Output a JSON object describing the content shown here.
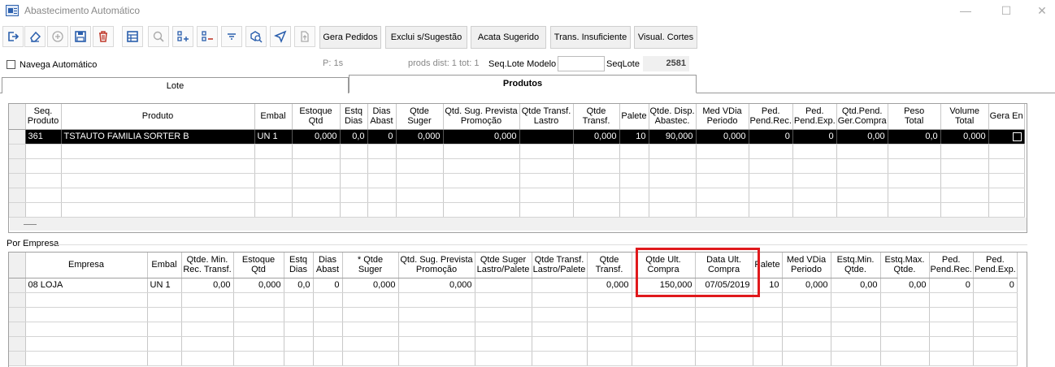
{
  "window": {
    "title": "Abastecimento Automático",
    "minimize": "—",
    "maximize": "☐",
    "close": "✕"
  },
  "toolbar": {
    "icons": [
      "exit-icon",
      "eraser-icon",
      "add-icon",
      "save-icon",
      "delete-icon",
      "table-icon",
      "search-icon",
      "add-row-icon",
      "remove-row-icon",
      "filter-icon",
      "inspect-icon",
      "send-icon",
      "export-icon"
    ],
    "buttons": [
      "Gera Pedidos",
      "Exclui s/Sugestão",
      "Acata Sugerido",
      "Trans. Insuficiente",
      "Visual. Cortes"
    ]
  },
  "info": {
    "navega_label": "Navega Automático",
    "p_label": "P: 1s",
    "prods_label": "prods dist: 1  tot: 1",
    "seq_lote_modelo_label": "Seq.Lote Modelo",
    "seq_lote_modelo_value": "",
    "seqlote_label": "SeqLote",
    "seqlote_value": "2581"
  },
  "tabs": [
    "Lote",
    "Produtos"
  ],
  "products_grid": {
    "headers": [
      [
        "Seq.",
        "Produto"
      ],
      [
        "Produto",
        ""
      ],
      [
        "Embal",
        ""
      ],
      [
        "Estoque",
        "Qtd"
      ],
      [
        "Estq",
        "Dias"
      ],
      [
        "Dias",
        "Abast"
      ],
      [
        "Qtde",
        "Suger"
      ],
      [
        "Qtd. Sug. Prevista",
        "Promoção"
      ],
      [
        "Qtde Transf.",
        "Lastro"
      ],
      [
        "Qtde",
        "Transf."
      ],
      [
        "Palete",
        ""
      ],
      [
        "Qtde. Disp.",
        "Abastec."
      ],
      [
        "Med VDia",
        "Periodo"
      ],
      [
        "Ped.",
        "Pend.Rec."
      ],
      [
        "Ped.",
        "Pend.Exp."
      ],
      [
        "Qtd.Pend.",
        "Ger.Compra"
      ],
      [
        "Peso",
        "Total"
      ],
      [
        "Volume",
        "Total"
      ],
      [
        "Gera En",
        ""
      ]
    ],
    "rows": [
      [
        "361",
        "TSTAUTO FAMILIA SORTER B",
        "UN 1",
        "0,000",
        "0,0",
        "0",
        "0,000",
        "0,000",
        "",
        "0,000",
        "10",
        "90,000",
        "0,000",
        "0",
        "0",
        "0,00",
        "0,0",
        "0,000",
        ""
      ]
    ]
  },
  "section_label": "Por Empresa",
  "company_grid": {
    "headers": [
      [
        "Empresa",
        ""
      ],
      [
        "Embal",
        ""
      ],
      [
        "Qtde. Min.",
        "Rec. Transf."
      ],
      [
        "Estoque",
        "Qtd"
      ],
      [
        "Estq",
        "Dias"
      ],
      [
        "Dias",
        "Abast"
      ],
      [
        "* Qtde",
        "Suger"
      ],
      [
        "Qtd. Sug. Prevista",
        "Promoção"
      ],
      [
        "Qtde Suger",
        "Lastro/Palete"
      ],
      [
        "Qtde Transf.",
        "Lastro/Palete"
      ],
      [
        "Qtde",
        "Transf."
      ],
      [
        "Qtde Ult.",
        "Compra"
      ],
      [
        "Data Ult.",
        "Compra"
      ],
      [
        "Palete",
        ""
      ],
      [
        "Med VDia",
        "Periodo"
      ],
      [
        "Estq.Min.",
        "Qtde."
      ],
      [
        "Estq.Max.",
        "Qtde."
      ],
      [
        "Ped.",
        "Pend.Rec."
      ],
      [
        "Ped.",
        "Pend.Exp."
      ]
    ],
    "rows": [
      [
        "08 LOJA",
        "UN 1",
        "0,00",
        "0,000",
        "0,0",
        "0",
        "0,000",
        "0,000",
        "",
        "",
        "0,000",
        "150,000",
        "07/05/2019",
        "10",
        "0,000",
        "0,00",
        "0,00",
        "0",
        "0"
      ]
    ]
  },
  "colors": {
    "highlight": "#e0191c",
    "selected_row": "#000000",
    "icon_blue": "#2b5fad",
    "icon_red": "#c0392b"
  }
}
